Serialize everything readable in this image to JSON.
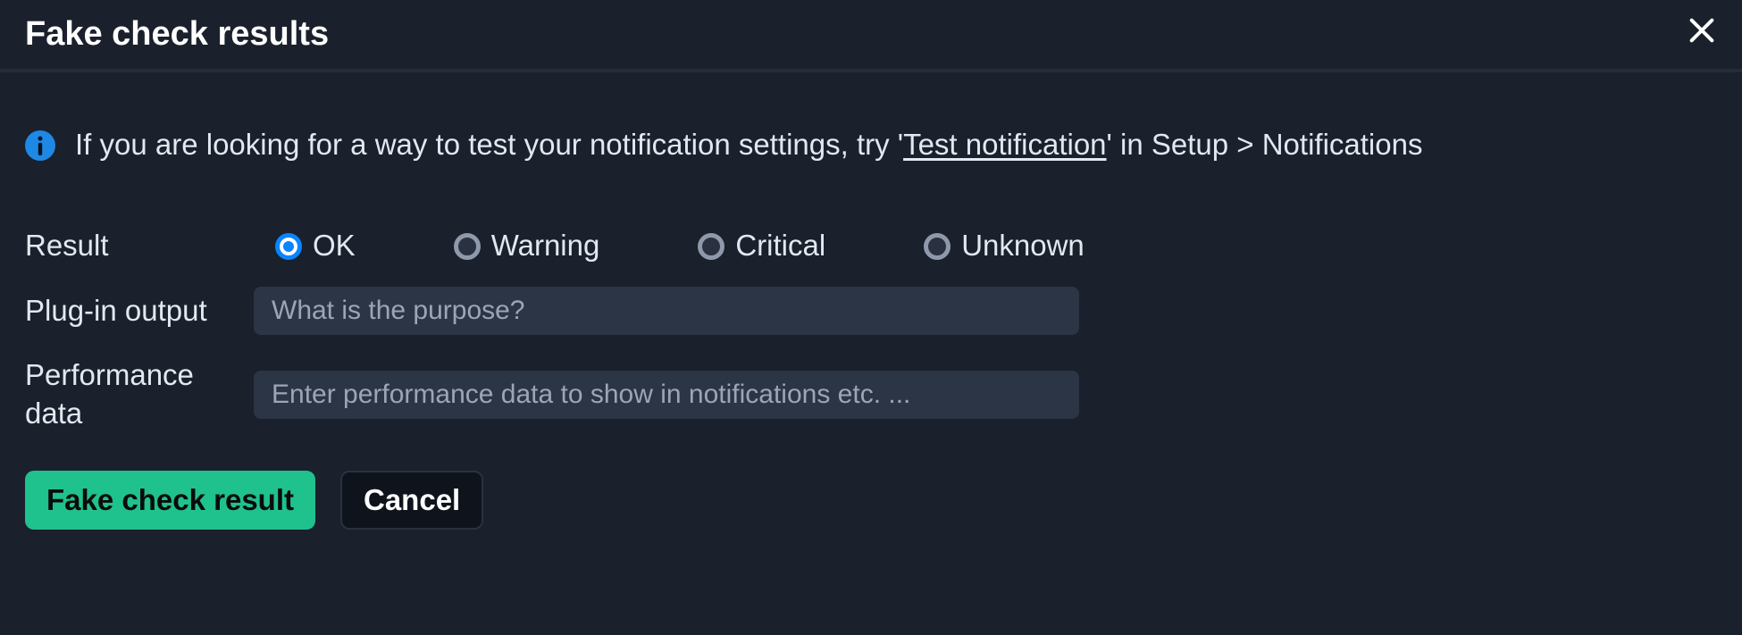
{
  "dialog": {
    "title": "Fake check results"
  },
  "info": {
    "prefix": "If you are looking for a way to test your notification settings, try '",
    "link": "Test notification",
    "suffix": "' in Setup > Notifications"
  },
  "form": {
    "result": {
      "label": "Result",
      "options": {
        "ok": "OK",
        "warning": "Warning",
        "critical": "Critical",
        "unknown": "Unknown"
      },
      "selected": "ok"
    },
    "plugin_output": {
      "label": "Plug-in output",
      "placeholder": "What is the purpose?",
      "value": ""
    },
    "perf_data": {
      "label": "Performance data",
      "placeholder": "Enter performance data to show in notifications etc. ...",
      "value": ""
    }
  },
  "actions": {
    "submit": "Fake check result",
    "cancel": "Cancel"
  }
}
